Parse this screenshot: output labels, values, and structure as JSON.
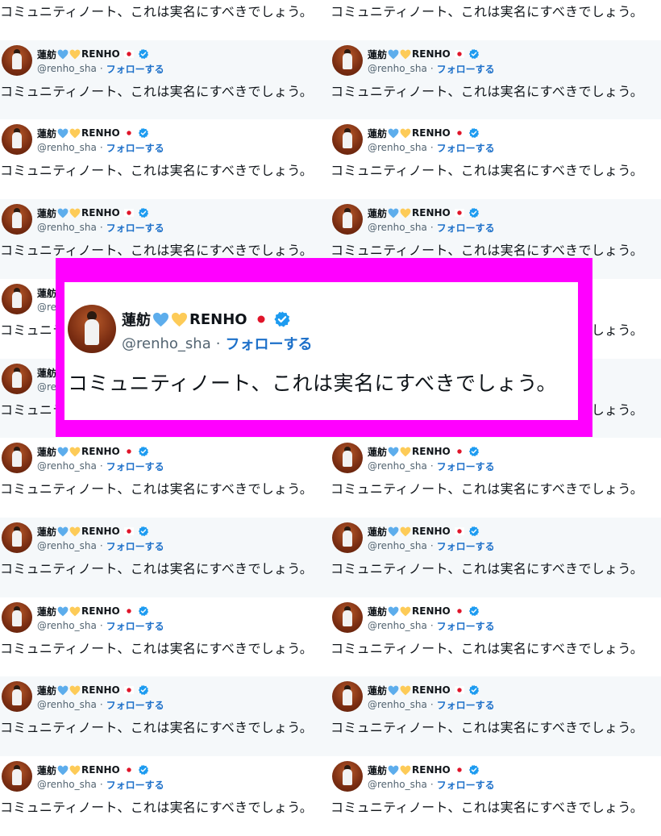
{
  "tweet": {
    "display_name": "蓮舫",
    "name_suffix": "RENHO",
    "handle": "@renho_sha",
    "separator": "·",
    "follow_label": "フォローする",
    "text": "コミュニティノート、これは実名にすべきでしょう。",
    "icons": [
      "blue-heart-icon",
      "yellow-heart-icon",
      "japan-flag-icon",
      "verified-badge-icon"
    ]
  },
  "colors": {
    "highlight_frame": "#ff00ff",
    "follow_link": "#1d70c9",
    "verified_badge": "#1d9bf0",
    "blue_heart": "#5dadec",
    "yellow_heart": "#fdcb58",
    "flag_dot": "#e0152a"
  },
  "grid": {
    "columns": 2,
    "rows": 11
  }
}
